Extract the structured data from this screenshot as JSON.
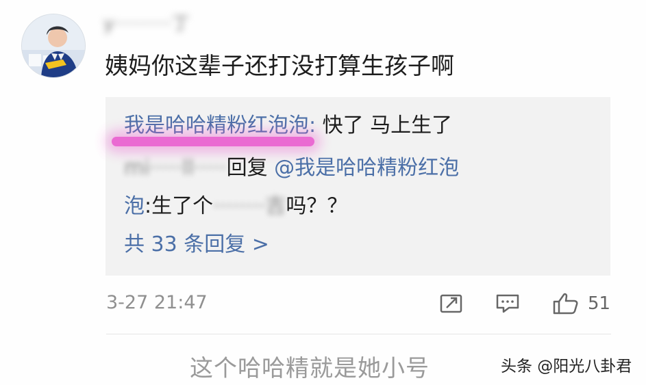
{
  "comment": {
    "username": "y·········丁",
    "text": "姨妈你这辈子还打没打算生孩子啊",
    "timestamp": "3-27 21:47",
    "like_count": "51"
  },
  "replies": {
    "first": {
      "author": "我是哈哈精粉红泡泡",
      "separator": ":",
      "text": " 快了  马上生了"
    },
    "second": {
      "blurred_author": "mi·····ll·····",
      "reply_prefix": "回复",
      "mention_line1": " @我是哈哈精粉红泡",
      "mention_line2": "泡",
      "text_prefix": ":生了个",
      "blurred_mid": "········吉",
      "text_suffix": "吗？？"
    },
    "summary": "共 33 条回复 >"
  },
  "caption": "这个哈哈精就是她小号",
  "watermark": "头条 @阳光八卦君",
  "icons": {
    "share": "share-icon",
    "comment": "comment-icon",
    "like": "thumbs-up-icon",
    "avatar": "avatar-icon"
  },
  "colors": {
    "link_blue": "#4b6fa7",
    "highlight_pink": "#ea5ccf",
    "reply_bg": "#f2f2f2",
    "meta_gray": "#8f8f8f"
  }
}
